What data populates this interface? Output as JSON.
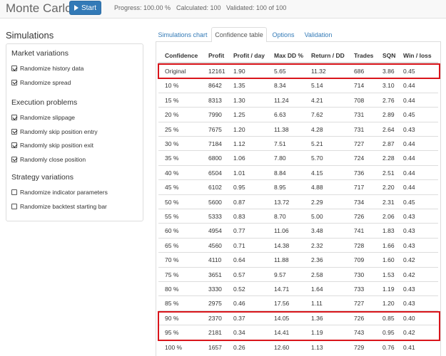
{
  "app": {
    "title": "Monte Carlo"
  },
  "toolbar": {
    "start_label": "Start",
    "progress": "Progress: 100.00 %",
    "calculated": "Calculated: 100",
    "validated": "Validated: 100 of 100"
  },
  "simulations": {
    "title": "Simulations",
    "groups": [
      {
        "title": "Market variations",
        "options": [
          {
            "label": "Randomize history data",
            "checked": true
          },
          {
            "label": "Randomize spread",
            "checked": true
          }
        ]
      },
      {
        "title": "Execution problems",
        "options": [
          {
            "label": "Randomize slippage",
            "checked": true
          },
          {
            "label": "Randomly skip position entry",
            "checked": true
          },
          {
            "label": "Randomly skip position exit",
            "checked": true
          },
          {
            "label": "Randomly close position",
            "checked": true
          }
        ]
      },
      {
        "title": "Strategy variations",
        "options": [
          {
            "label": "Randomize indicator parameters",
            "checked": false
          },
          {
            "label": "Randomize backtest starting bar",
            "checked": false
          }
        ]
      }
    ]
  },
  "tabs": [
    {
      "label": "Simulations chart",
      "active": false
    },
    {
      "label": "Confidence table",
      "active": true
    },
    {
      "label": "Options",
      "active": false
    },
    {
      "label": "Validation",
      "active": false
    }
  ],
  "table": {
    "columns": [
      "Confidence",
      "Profit",
      "Profit / day",
      "Max DD %",
      "Return / DD",
      "Trades",
      "SQN",
      "Win / loss"
    ],
    "rows": [
      [
        "Original",
        "12161",
        "1.90",
        "5.65",
        "11.32",
        "686",
        "3.86",
        "0.45"
      ],
      [
        "10 %",
        "8642",
        "1.35",
        "8.34",
        "5.14",
        "714",
        "3.10",
        "0.44"
      ],
      [
        "15 %",
        "8313",
        "1.30",
        "11.24",
        "4.21",
        "708",
        "2.76",
        "0.44"
      ],
      [
        "20 %",
        "7990",
        "1.25",
        "6.63",
        "7.62",
        "731",
        "2.89",
        "0.45"
      ],
      [
        "25 %",
        "7675",
        "1.20",
        "11.38",
        "4.28",
        "731",
        "2.64",
        "0.43"
      ],
      [
        "30 %",
        "7184",
        "1.12",
        "7.51",
        "5.21",
        "727",
        "2.87",
        "0.44"
      ],
      [
        "35 %",
        "6800",
        "1.06",
        "7.80",
        "5.70",
        "724",
        "2.28",
        "0.44"
      ],
      [
        "40 %",
        "6504",
        "1.01",
        "8.84",
        "4.15",
        "736",
        "2.51",
        "0.44"
      ],
      [
        "45 %",
        "6102",
        "0.95",
        "8.95",
        "4.88",
        "717",
        "2.20",
        "0.44"
      ],
      [
        "50 %",
        "5600",
        "0.87",
        "13.72",
        "2.29",
        "734",
        "2.31",
        "0.45"
      ],
      [
        "55 %",
        "5333",
        "0.83",
        "8.70",
        "5.00",
        "726",
        "2.06",
        "0.43"
      ],
      [
        "60 %",
        "4954",
        "0.77",
        "11.06",
        "3.48",
        "741",
        "1.83",
        "0.43"
      ],
      [
        "65 %",
        "4560",
        "0.71",
        "14.38",
        "2.32",
        "728",
        "1.66",
        "0.43"
      ],
      [
        "70 %",
        "4110",
        "0.64",
        "11.88",
        "2.36",
        "709",
        "1.60",
        "0.42"
      ],
      [
        "75 %",
        "3651",
        "0.57",
        "9.57",
        "2.58",
        "730",
        "1.53",
        "0.42"
      ],
      [
        "80 %",
        "3330",
        "0.52",
        "14.71",
        "1.64",
        "733",
        "1.19",
        "0.43"
      ],
      [
        "85 %",
        "2975",
        "0.46",
        "17.56",
        "1.11",
        "727",
        "1.20",
        "0.43"
      ],
      [
        "90 %",
        "2370",
        "0.37",
        "14.05",
        "1.36",
        "726",
        "0.85",
        "0.40"
      ],
      [
        "95 %",
        "2181",
        "0.34",
        "14.41",
        "1.19",
        "743",
        "0.95",
        "0.42"
      ],
      [
        "100 %",
        "1657",
        "0.26",
        "12.60",
        "1.13",
        "729",
        "0.76",
        "0.41"
      ]
    ]
  },
  "colors": {
    "accent": "#337ab7",
    "highlight": "#d9151b"
  },
  "icons": {
    "start": "play-icon",
    "option": "checkbox-icon"
  }
}
